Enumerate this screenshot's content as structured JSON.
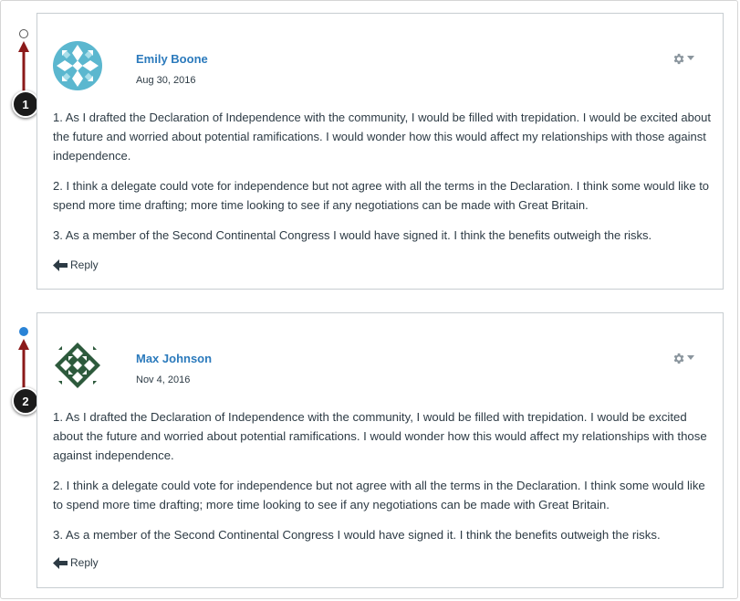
{
  "entries": [
    {
      "author": "Emily Boone",
      "date": "Aug 30, 2016",
      "paragraphs": [
        "1. As I drafted the Declaration of Independence with the community, I would be filled with trepidation. I would be excited about the future and worried about potential ramifications. I would wonder how this would affect my relationships with those against independence.",
        "2. I think a delegate could vote for independence but not agree with all the terms in the Declaration. I think some would like to spend more time drafting; more time looking to see if any negotiations can be made with Great Britain.",
        "3. As a member of the Second Continental Congress I would have signed it. I think the benefits outweigh the risks."
      ],
      "reply_label": "Reply",
      "read_state": "read",
      "avatar_color": "#5bb7cf",
      "step_number": "1"
    },
    {
      "author": "Max Johnson",
      "date": "Nov 4, 2016",
      "paragraphs": [
        "1. As I drafted the Declaration of Independence with the community, I would be filled with trepidation. I would be excited about the future and worried about potential ramifications. I would wonder how this would affect my relationships with those against independence.",
        "2. I think a delegate could vote for independence but not agree with all the terms in the Declaration. I think some would like to spend more time drafting; more time looking to see if any negotiations can be made with Great Britain.",
        "3. As a member of the Second Continental Congress I would have signed it. I think the benefits outweigh the risks."
      ],
      "reply_label": "Reply",
      "read_state": "unread",
      "avatar_color": "#2d5a3c",
      "step_number": "2"
    }
  ],
  "colors": {
    "link": "#2b7abc",
    "unread_dot": "#2a83d6",
    "annotation_arrow": "#8b1a1a",
    "border": "#c7cdd1"
  },
  "icons": {
    "settings": "gear-icon",
    "menu_caret": "caret-down-icon",
    "reply": "reply-arrow-icon"
  }
}
